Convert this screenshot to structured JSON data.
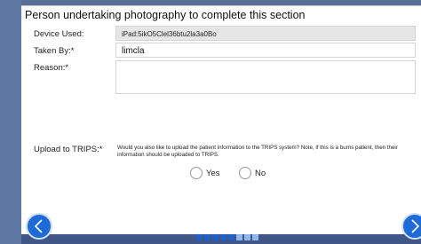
{
  "section": {
    "title": "Person undertaking photography to complete this section"
  },
  "device": {
    "label": "Device Used:",
    "value": "iPad:5ikO5Clel36btu2la3a0Bo"
  },
  "taken_by": {
    "label": "Taken By:*",
    "value": "limcla"
  },
  "reason": {
    "label": "Reason:*",
    "value": ""
  },
  "upload": {
    "label": "Upload to TRIPS:*",
    "question": "Would you also like to upload the patient information to the TRIPS system? Note, if this is a burns patient, then their information should be uploaded to TRIPS.",
    "options": [
      "Yes",
      "No"
    ]
  },
  "pager": {
    "total": 8,
    "active": 5
  },
  "colors": {
    "nav_button": "#1e6ad6",
    "pager_active": "#1f5fc8",
    "pager_inactive": "#8fb7ec"
  },
  "icons": {
    "back": "chevron-left-icon",
    "next": "chevron-right-icon"
  }
}
